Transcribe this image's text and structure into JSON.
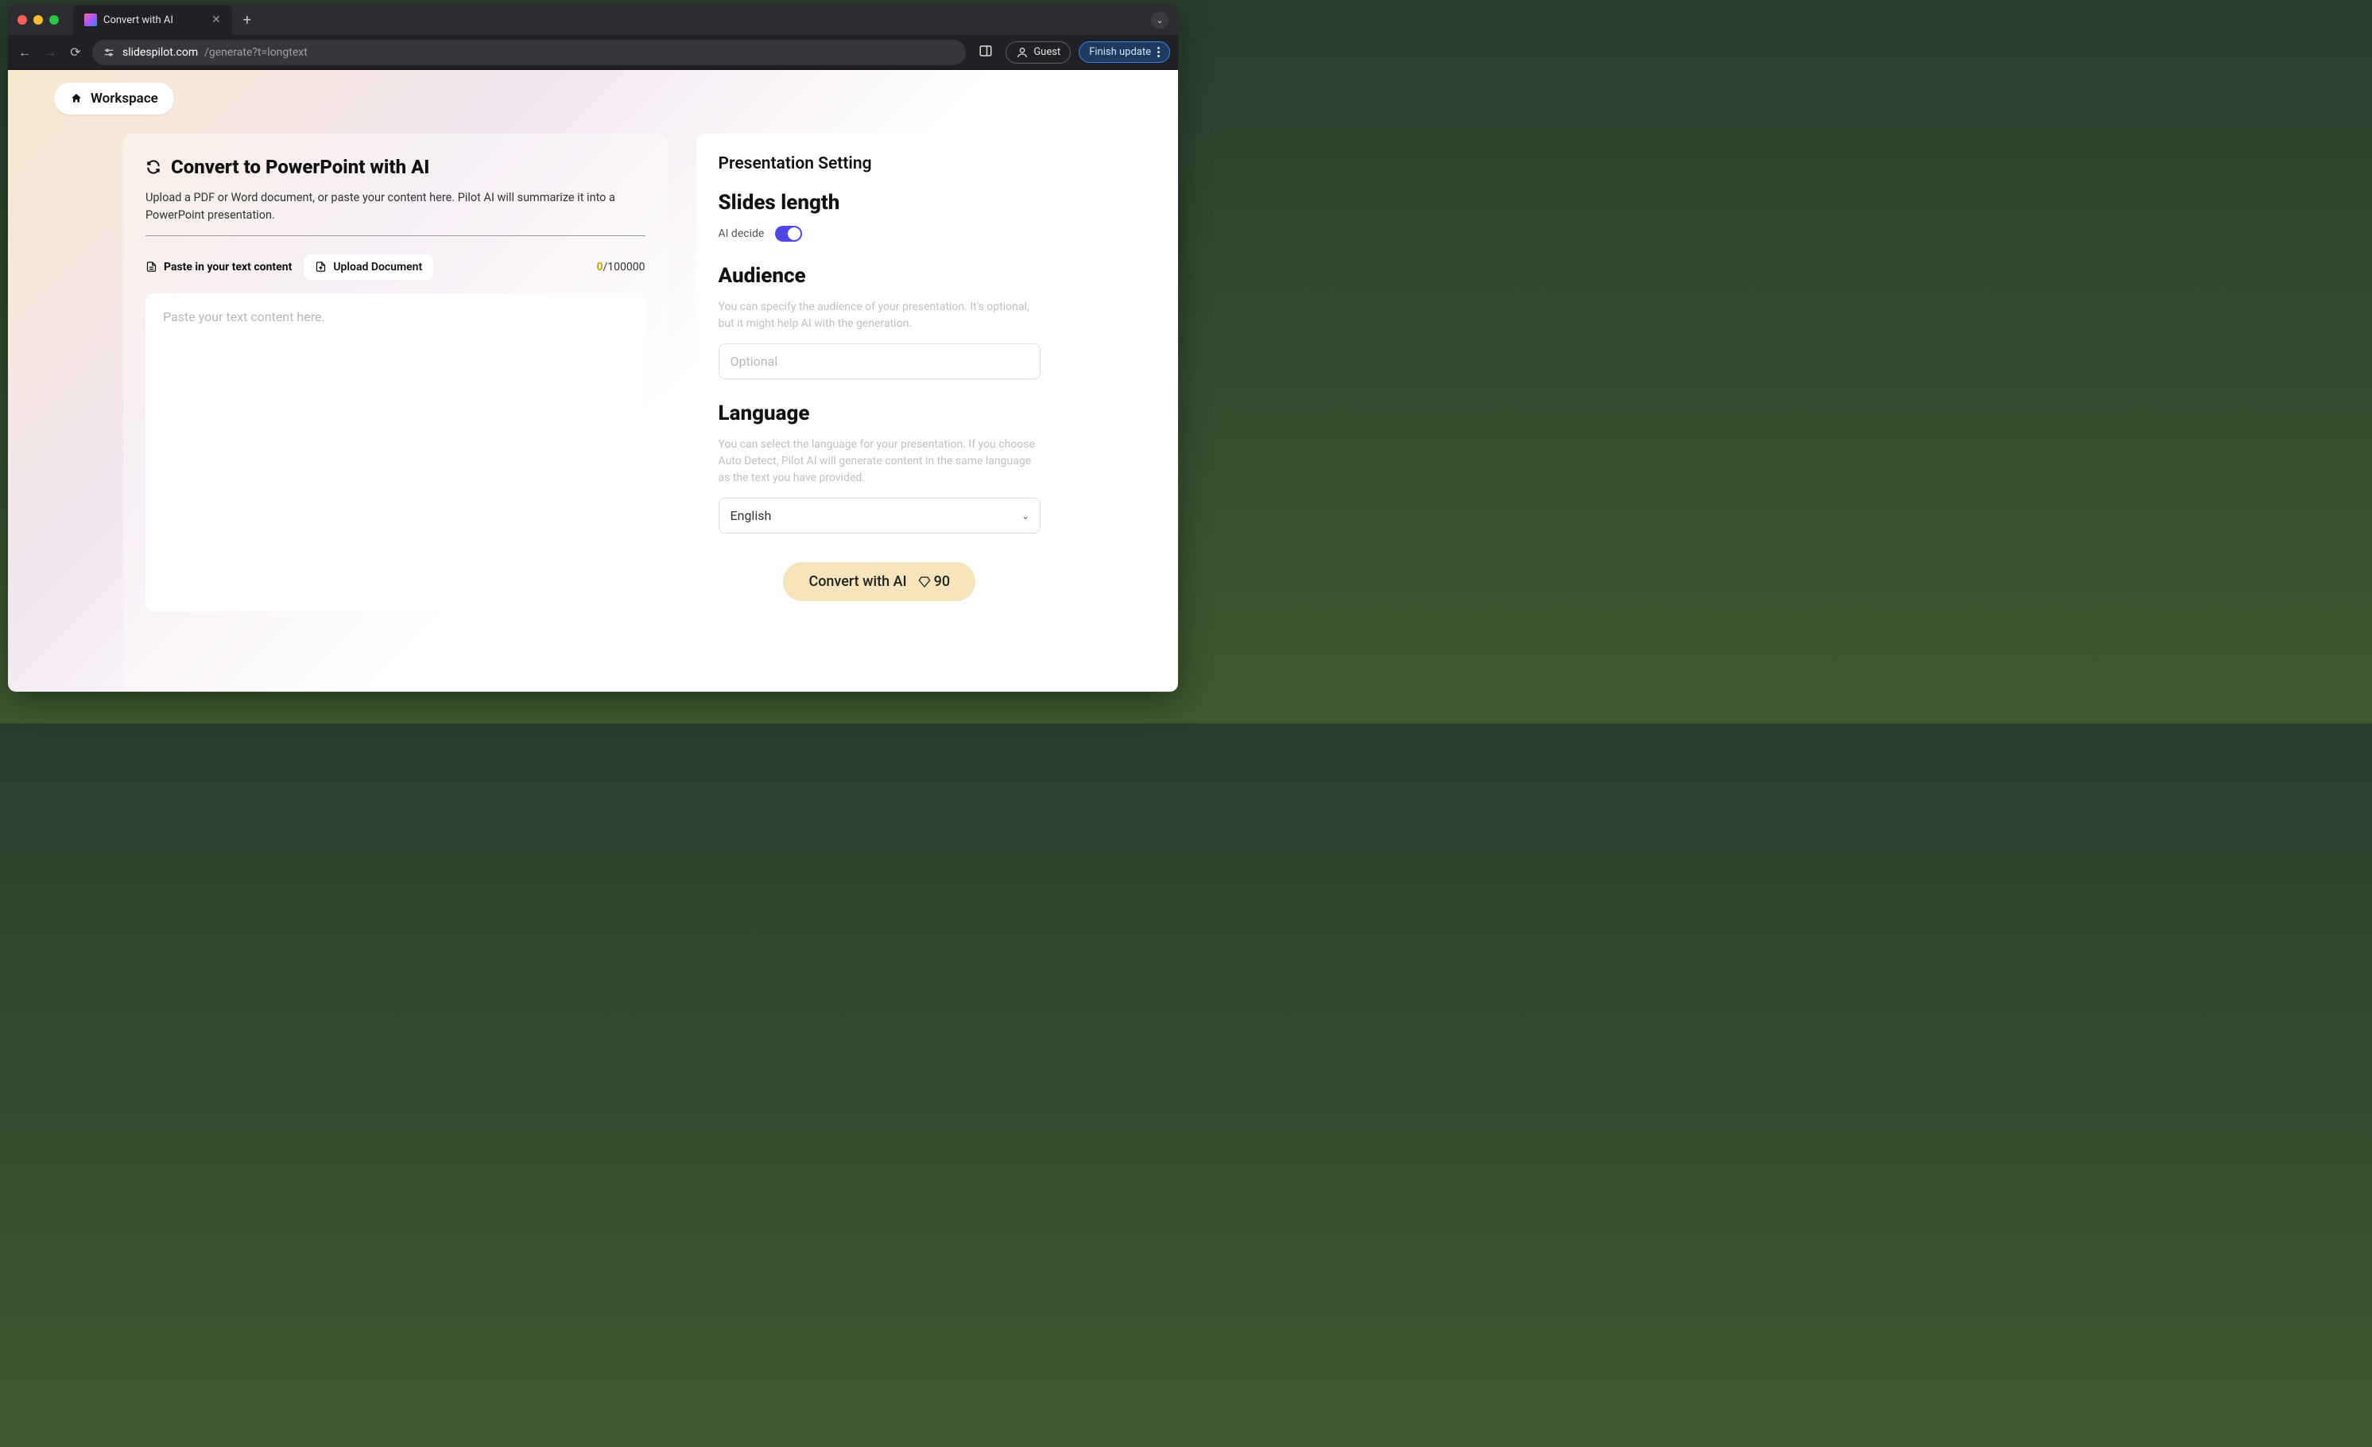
{
  "browser": {
    "tab_title": "Convert with AI",
    "url_host": "slidespilot.com",
    "url_path": "/generate?t=longtext",
    "guest_label": "Guest",
    "update_label": "Finish update"
  },
  "workspace_button": "Workspace",
  "convert_panel": {
    "title": "Convert to PowerPoint with AI",
    "description": "Upload a PDF or Word document, or paste your content here. Pilot AI will summarize it into a PowerPoint presentation.",
    "tab_paste": "Paste in your text content",
    "tab_upload": "Upload Document",
    "char_current": "0",
    "char_max": "/100000",
    "placeholder": "Paste your text content here."
  },
  "settings": {
    "title": "Presentation Setting",
    "slides_length": {
      "heading": "Slides length",
      "toggle_label": "AI decide",
      "toggle_on": true
    },
    "audience": {
      "heading": "Audience",
      "description": "You can specify the audience of your presentation. It's optional, but it might help AI with the generation.",
      "placeholder": "Optional"
    },
    "language": {
      "heading": "Language",
      "description": "You can select the language for your presentation. If you choose Auto Detect, Pilot AI will generate content in the same language as the text you have provided.",
      "selected": "English"
    },
    "convert_button": "Convert with AI",
    "credits": "90"
  }
}
